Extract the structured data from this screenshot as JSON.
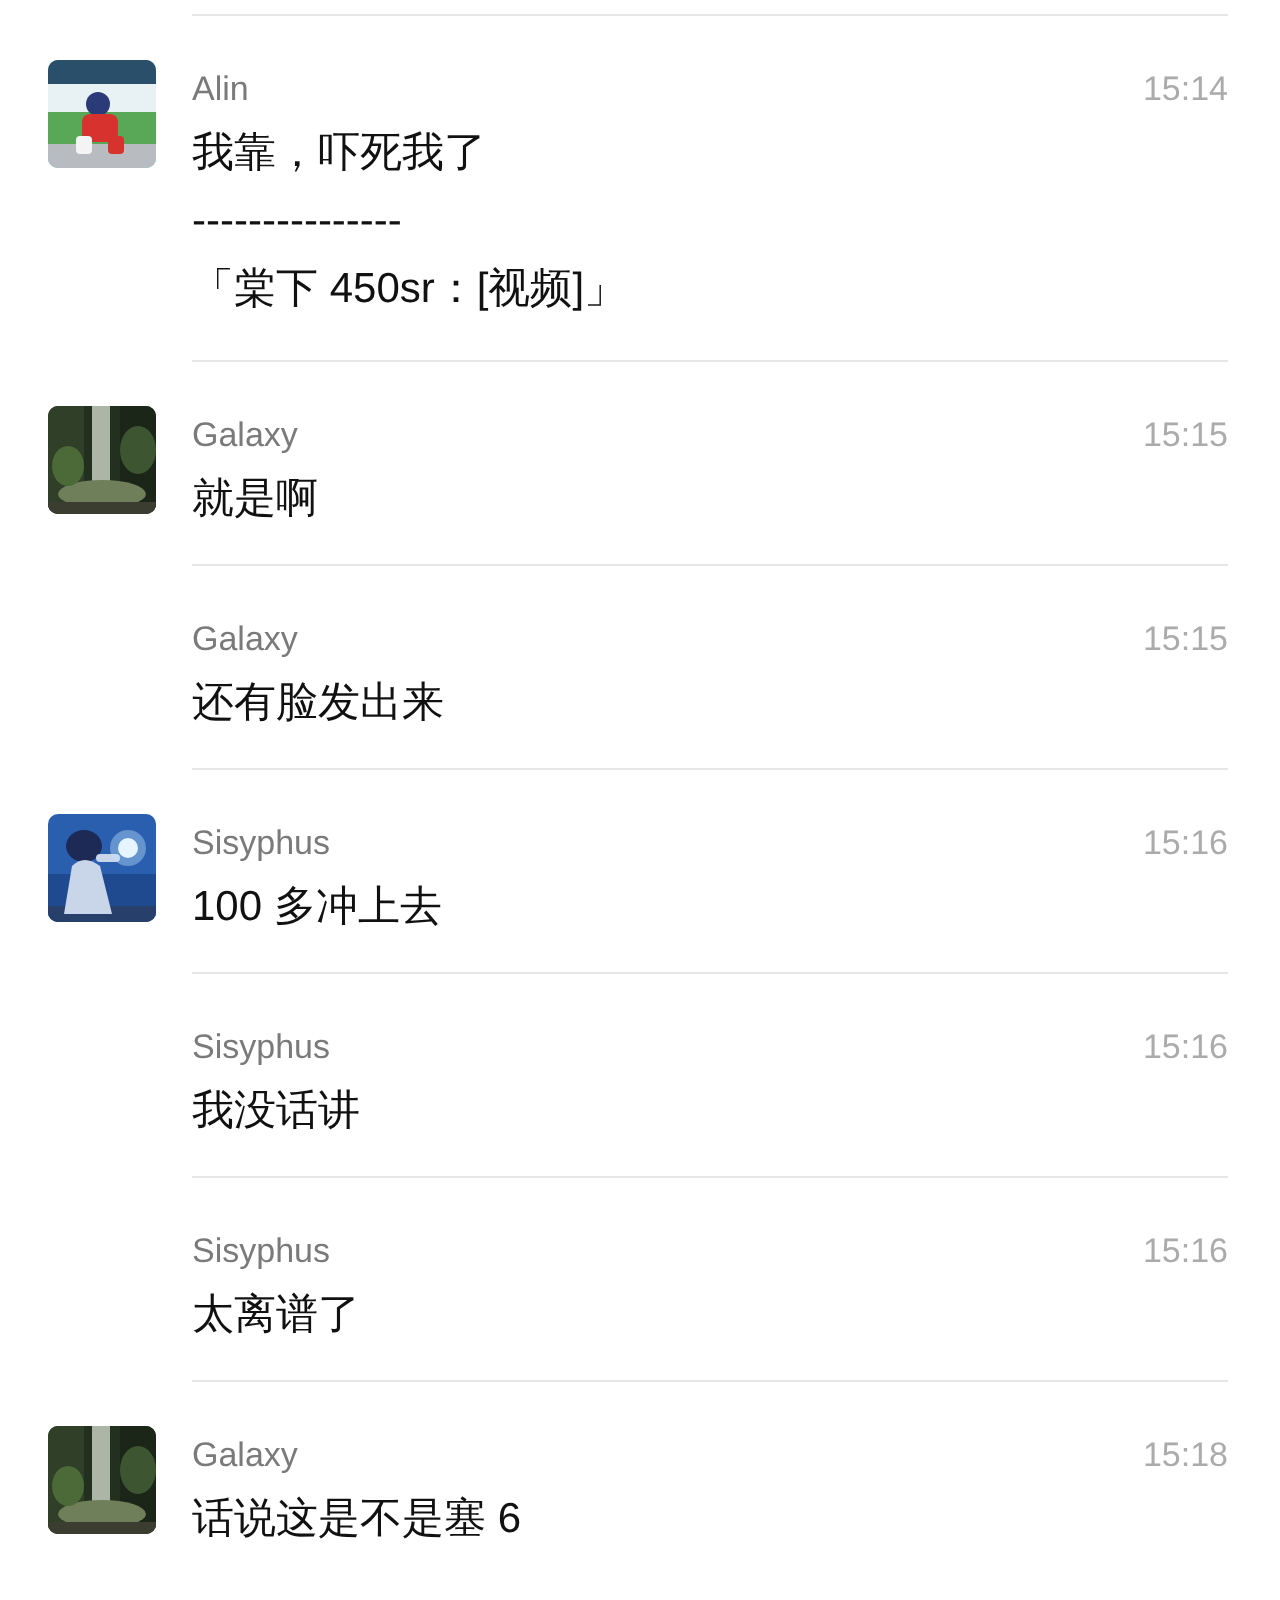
{
  "messages": [
    {
      "avatar": {
        "kind": "track"
      },
      "sender": "Alin",
      "time": "15:14",
      "lines": [
        "我靠，吓死我了",
        "---------------",
        "「棠下 450sr：[视频]」"
      ]
    },
    {
      "avatar": {
        "kind": "forest"
      },
      "sender": "Galaxy",
      "time": "15:15",
      "lines": [
        "就是啊"
      ]
    },
    {
      "sender": "Galaxy",
      "time": "15:15",
      "lines": [
        "还有脸发出来"
      ]
    },
    {
      "avatar": {
        "kind": "night"
      },
      "sender": "Sisyphus",
      "time": "15:16",
      "lines": [
        "100 多冲上去"
      ]
    },
    {
      "sender": "Sisyphus",
      "time": "15:16",
      "lines": [
        "我没话讲"
      ]
    },
    {
      "sender": "Sisyphus",
      "time": "15:16",
      "lines": [
        "太离谱了"
      ]
    },
    {
      "avatar": {
        "kind": "forest"
      },
      "sender": "Galaxy",
      "time": "15:18",
      "lines": [
        "话说这是不是塞 6"
      ]
    }
  ]
}
